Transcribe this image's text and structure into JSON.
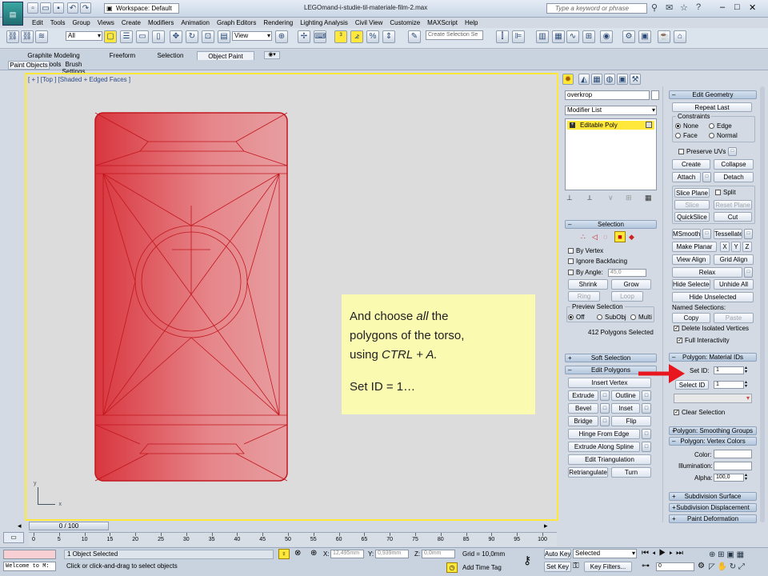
{
  "title_bar": {
    "workspace_label": "Workspace: Default",
    "file_title": "LEGOmand-i-studie-til-materiale-film-2.max",
    "search_placeholder": "Type a keyword or phrase"
  },
  "menu": [
    "Edit",
    "Tools",
    "Group",
    "Views",
    "Create",
    "Modifiers",
    "Animation",
    "Graph Editors",
    "Rendering",
    "Lighting Analysis",
    "Civil View",
    "Customize",
    "MAXScript",
    "Help"
  ],
  "toolbar": {
    "selection_filter": "All",
    "coord_system": "View",
    "selection_set_placeholder": "Create Selection Se"
  },
  "ribbon_tabs": [
    "Graphite Modeling Tools",
    "Freeform",
    "Selection",
    "Object Paint"
  ],
  "ribbon_subtabs": [
    "Paint Objects",
    "Brush Settings"
  ],
  "viewport_label": "[ + ] [Top ] [Shaded + Edged Faces ]",
  "annotation": {
    "line1_pre": "And choose ",
    "line1_em": "all",
    "line1_post": " the",
    "line2": "polygons of the torso,",
    "line3_pre": "using ",
    "line3_em": "CTRL + A.",
    "line4": "Set ID = 1…"
  },
  "command_panel": {
    "object_name": "overkrop",
    "modifier_list": "Modifier List",
    "stack_item": "Editable Poly"
  },
  "selection_rollout": {
    "title": "Selection",
    "by_vertex": "By Vertex",
    "ignore_backfacing": "Ignore Backfacing",
    "by_angle": "By Angle:",
    "angle_value": "45,0",
    "shrink": "Shrink",
    "grow": "Grow",
    "ring": "Ring",
    "loop": "Loop",
    "preview_title": "Preview Selection",
    "off": "Off",
    "subobj": "SubObj",
    "multi": "Multi",
    "status": "412 Polygons Selected"
  },
  "soft_selection": {
    "title": "Soft Selection"
  },
  "edit_polygons": {
    "title": "Edit Polygons",
    "insert_vertex": "Insert Vertex",
    "extrude": "Extrude",
    "outline": "Outline",
    "bevel": "Bevel",
    "inset": "Inset",
    "bridge": "Bridge",
    "flip": "Flip",
    "hinge": "Hinge From Edge",
    "extrude_spline": "Extrude Along Spline",
    "edit_tri": "Edit Triangulation",
    "retriangulate": "Retriangulate",
    "turn": "Turn"
  },
  "edit_geometry": {
    "title": "Edit Geometry",
    "repeat_last": "Repeat Last",
    "constraints": "Constraints",
    "none": "None",
    "edge": "Edge",
    "face": "Face",
    "normal": "Normal",
    "preserve_uvs": "Preserve UVs",
    "create": "Create",
    "collapse": "Collapse",
    "attach": "Attach",
    "detach": "Detach",
    "slice_plane": "Slice Plane",
    "split": "Split",
    "slice": "Slice",
    "reset_plane": "Reset Plane",
    "quickslice": "QuickSlice",
    "cut": "Cut",
    "msmooth": "MSmooth",
    "tessellate": "Tessellate",
    "make_planar": "Make Planar",
    "x": "X",
    "y": "Y",
    "z": "Z",
    "view_align": "View Align",
    "grid_align": "Grid Align",
    "relax": "Relax",
    "hide_selected": "Hide Selected",
    "unhide_all": "Unhide All",
    "hide_unselected": "Hide Unselected",
    "named_selections": "Named Selections:",
    "copy": "Copy",
    "paste": "Paste",
    "delete_isolated": "Delete Isolated Vertices",
    "full_interactivity": "Full Interactivity"
  },
  "material_ids": {
    "title": "Polygon: Material IDs",
    "set_id_label": "Set ID:",
    "set_id_value": "1",
    "select_id_label": "Select ID",
    "select_id_value": "1",
    "clear_selection": "Clear Selection"
  },
  "smoothing_groups": {
    "title": "Polygon: Smoothing Groups"
  },
  "vertex_colors": {
    "title": "Polygon: Vertex Colors",
    "color": "Color:",
    "illumination": "Illumination:",
    "alpha": "Alpha:",
    "alpha_value": "100,0"
  },
  "bottom_rollouts": [
    "Subdivision Surface",
    "Subdivision Displacement",
    "Paint Deformation"
  ],
  "timeline": {
    "frame": "0 / 100",
    "ticks": [
      "0",
      "5",
      "10",
      "15",
      "20",
      "25",
      "30",
      "35",
      "40",
      "45",
      "50",
      "55",
      "60",
      "65",
      "70",
      "75",
      "80",
      "85",
      "90",
      "95",
      "100"
    ]
  },
  "status_bar": {
    "welcome": "Welcome to M:",
    "selected": "1 Object Selected",
    "prompt": "Click or click-and-drag to select objects",
    "x_label": "X:",
    "x_value": "12,495mm",
    "y_label": "Y:",
    "y_value": "0,939mm",
    "z_label": "Z:",
    "z_value": "0,0mm",
    "grid": "Grid = 10,0mm",
    "add_time_tag": "Add Time Tag",
    "auto_key": "Auto Key",
    "auto_key_mode": "Selected",
    "set_key": "Set Key",
    "key_filters": "Key Filters...",
    "current_frame": "0"
  },
  "colors": {
    "accent_yellow": "#ffe83a",
    "mesh_red": "#d9363e",
    "note_bg": "#fafab1",
    "arrow": "#e8161e"
  }
}
